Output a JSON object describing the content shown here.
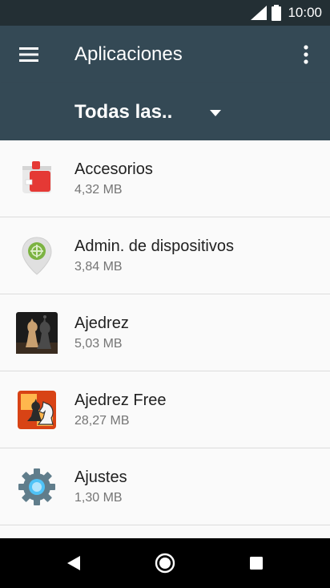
{
  "status_bar": {
    "time": "10:00",
    "icons": [
      "signal-icon",
      "battery-icon"
    ]
  },
  "app_bar": {
    "title": "Aplicaciones",
    "menu_icon": "hamburger-menu-icon",
    "more_icon": "more-vert-icon"
  },
  "filter": {
    "selected": "Todas las..",
    "icon": "dropdown-arrow-icon"
  },
  "apps": [
    {
      "name": "Accesorios",
      "size": "4,32 MB",
      "icon": "accessories-icon"
    },
    {
      "name": "Admin. de dispositivos",
      "size": "3,84 MB",
      "icon": "device-admin-icon"
    },
    {
      "name": "Ajedrez",
      "size": "5,03 MB",
      "icon": "chess-icon"
    },
    {
      "name": "Ajedrez Free",
      "size": "28,27 MB",
      "icon": "chess-free-icon"
    },
    {
      "name": "Ajustes",
      "size": "1,30 MB",
      "icon": "settings-gear-icon"
    }
  ],
  "nav_bar": {
    "icons": [
      "back-icon",
      "home-icon",
      "recents-icon"
    ]
  },
  "colors": {
    "app_bar": "#344955",
    "status_bar": "#232f34",
    "background": "#fafafa",
    "accent_red": "#e53935",
    "accent_green": "#7cb342"
  }
}
